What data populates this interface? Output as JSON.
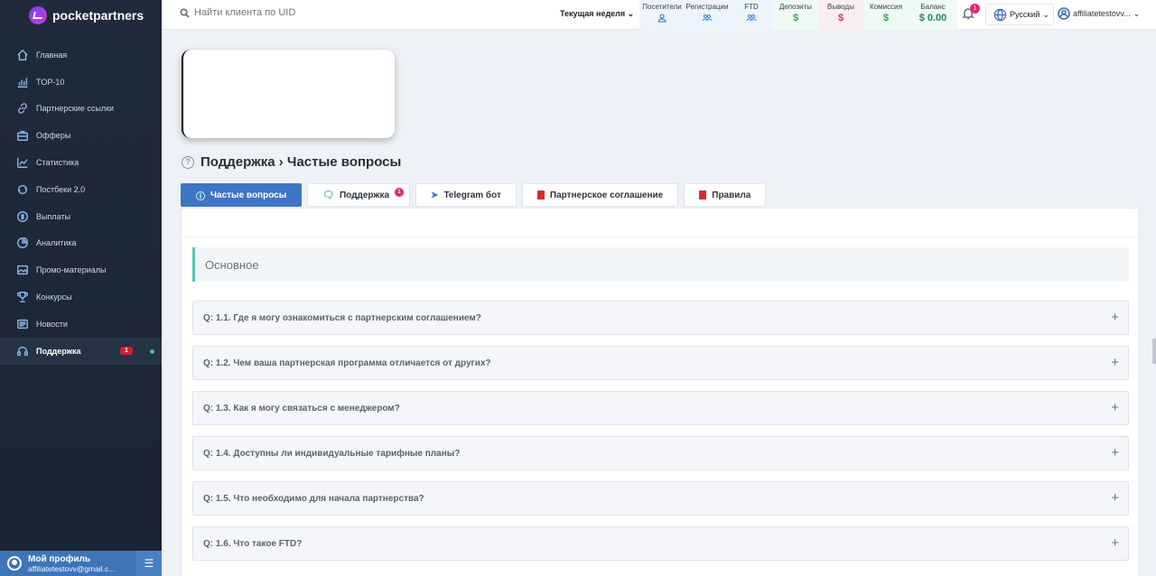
{
  "brand": {
    "name": "pocketpartners"
  },
  "sidebar": {
    "items": [
      {
        "label": "Главная",
        "icon": "home-icon"
      },
      {
        "label": "TOP-10",
        "icon": "chart-bars-icon"
      },
      {
        "label": "Партнерские ссылки",
        "icon": "link-icon"
      },
      {
        "label": "Офферы",
        "icon": "briefcase-icon"
      },
      {
        "label": "Статистика",
        "icon": "trend-icon"
      },
      {
        "label": "Постбеки 2.0",
        "icon": "postback-icon"
      },
      {
        "label": "Выплаты",
        "icon": "coin-icon"
      },
      {
        "label": "Аналитика",
        "icon": "pie-icon"
      },
      {
        "label": "Промо-материалы",
        "icon": "image-icon"
      },
      {
        "label": "Конкурсы",
        "icon": "trophy-icon"
      },
      {
        "label": "Новости",
        "icon": "news-icon"
      },
      {
        "label": "Поддержка",
        "icon": "support-icon",
        "badge": "1",
        "active": true
      }
    ]
  },
  "profile": {
    "title": "Мой профиль",
    "email": "affiliatetestovv@gmail.c..."
  },
  "topbar": {
    "search_placeholder": "Найти клиента по UID",
    "period": "Текущая неделя",
    "stats": [
      {
        "label": "Посетители",
        "value": "",
        "icon": "person-icon"
      },
      {
        "label": "Регистрации",
        "value": "",
        "icon": "people-icon"
      },
      {
        "label": "FTD",
        "value": "",
        "icon": "people-icon"
      },
      {
        "label": "Депозиты",
        "value": "$"
      },
      {
        "label": "Выводы",
        "value": "$"
      },
      {
        "label": "Комиссия",
        "value": "$"
      },
      {
        "label": "Баланс",
        "value": "$ 0.00"
      }
    ],
    "notifications": "1",
    "language": "Русский",
    "user": "affiliatetestovv..."
  },
  "page": {
    "title": "Поддержка › Частые вопросы",
    "tabs": [
      {
        "label": "Частые вопросы",
        "active": true
      },
      {
        "label": "Поддержка",
        "badge": "1"
      },
      {
        "label": "Telegram бот"
      },
      {
        "label": "Партнерское соглашение"
      },
      {
        "label": "Правила"
      }
    ],
    "section": "Основное",
    "faq": [
      "Q: 1.1. Где я могу ознакомиться с партнерским соглашением?",
      "Q: 1.2. Чем ваша партнерская программа отличается от других?",
      "Q: 1.3. Как я могу связаться с менеджером?",
      "Q: 1.4. Доступны ли индивидуальные тарифные планы?",
      "Q: 1.5. Что необходимо для начала партнерства?",
      "Q: 1.6. Что такое FTD?"
    ]
  },
  "colors": {
    "accent": "#3e75c4",
    "badge": "#e8247b",
    "sidebar": "#1f2a3c",
    "teal": "#58c4b6"
  }
}
